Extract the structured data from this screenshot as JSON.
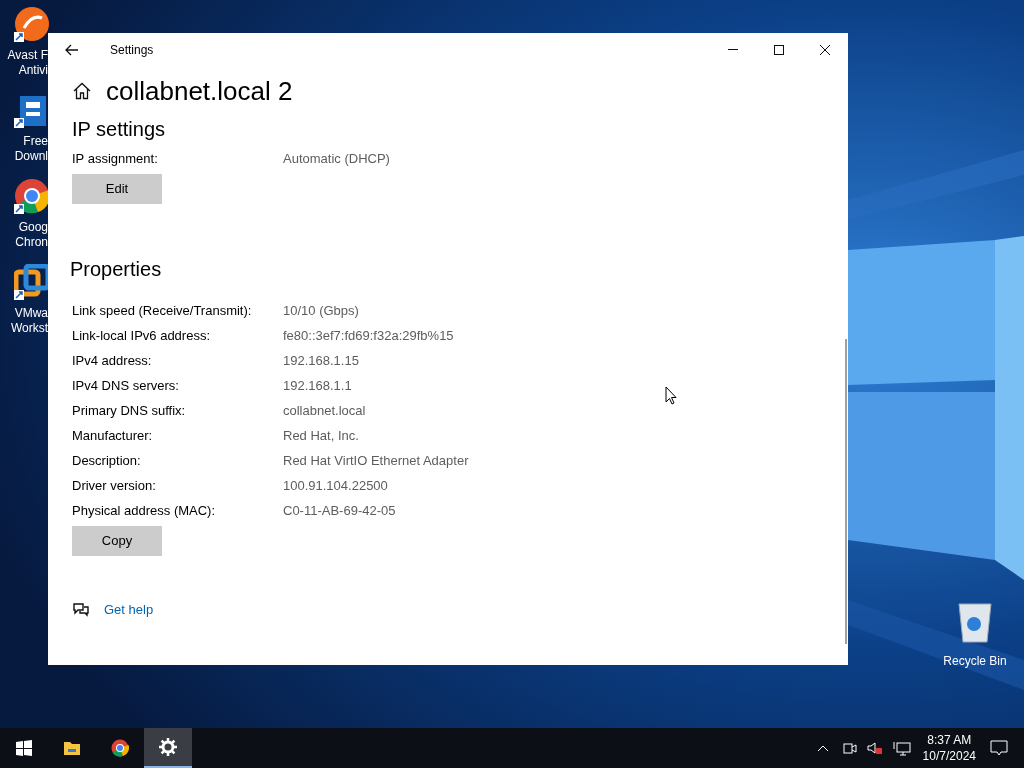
{
  "desktop_icons": [
    {
      "kind": "swirl",
      "lines": [
        "Avast F",
        "Antivi"
      ]
    },
    {
      "kind": "arrow-box",
      "lines": [
        "Free",
        "Downl"
      ]
    },
    {
      "kind": "browser",
      "lines": [
        "Goog",
        "Chron"
      ]
    },
    {
      "kind": "boxes",
      "lines": [
        "VMwa",
        "Workst"
      ]
    }
  ],
  "recycle_bin": {
    "label": "Recycle Bin"
  },
  "window": {
    "title": "Settings",
    "heading": "collabnet.local 2",
    "ip_settings": {
      "heading": "IP settings",
      "rows": [
        {
          "label": "IP assignment:",
          "value": "Automatic (DHCP)"
        }
      ],
      "button": "Edit"
    },
    "properties": {
      "heading": "Properties",
      "rows": [
        {
          "label": "Link speed (Receive/Transmit):",
          "value": "10/10 (Gbps)"
        },
        {
          "label": "Link-local IPv6 address:",
          "value": "fe80::3ef7:fd69:f32a:29fb%15"
        },
        {
          "label": "IPv4 address:",
          "value": "192.168.1.15"
        },
        {
          "label": "IPv4 DNS servers:",
          "value": "192.168.1.1"
        },
        {
          "label": "Primary DNS suffix:",
          "value": "collabnet.local"
        },
        {
          "label": "Manufacturer:",
          "value": "Red Hat, Inc."
        },
        {
          "label": "Description:",
          "value": "Red Hat VirtIO Ethernet Adapter"
        },
        {
          "label": "Driver version:",
          "value": "100.91.104.22500"
        },
        {
          "label": "Physical address (MAC):",
          "value": "C0-11-AB-69-42-05"
        }
      ],
      "button": "Copy"
    },
    "help_link": "Get help"
  },
  "taskbar": {
    "items": [
      {
        "kind": "start",
        "selected": false
      },
      {
        "kind": "folder",
        "selected": false
      },
      {
        "kind": "browser",
        "selected": false
      },
      {
        "kind": "gear",
        "selected": true
      }
    ],
    "time": "8:37 AM",
    "date": "10/7/2024"
  }
}
